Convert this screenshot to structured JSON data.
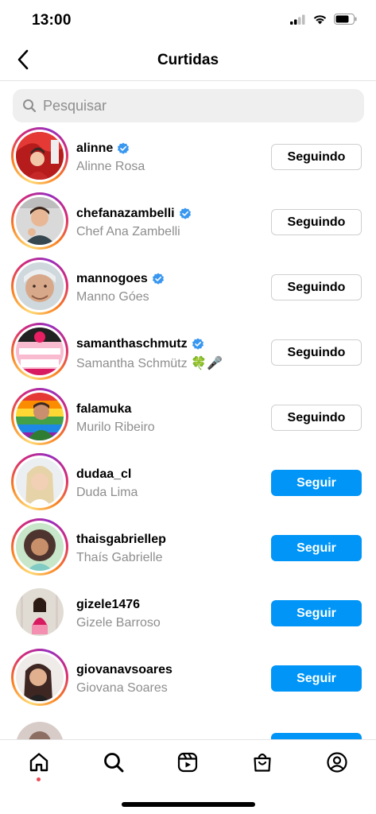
{
  "status_bar": {
    "time": "13:00",
    "icons": [
      "signal-icon",
      "wifi-icon",
      "battery-icon"
    ]
  },
  "header": {
    "title": "Curtidas",
    "back_icon": "chevron-left-icon"
  },
  "search": {
    "placeholder": "Pesquisar",
    "value": ""
  },
  "colors": {
    "accent": "#0095f6",
    "secondary_text": "#8e8e8e",
    "verified": "#3897f0",
    "notification_dot": "#ed4956"
  },
  "users": [
    {
      "username": "alinne",
      "full_name": "Alinne Rosa",
      "verified": true,
      "button": "Seguindo",
      "has_story": true
    },
    {
      "username": "chefanazambelli",
      "full_name": "Chef Ana Zambelli",
      "verified": true,
      "button": "Seguindo",
      "has_story": true
    },
    {
      "username": "mannogoes",
      "full_name": "Manno Góes",
      "verified": true,
      "button": "Seguindo",
      "has_story": true
    },
    {
      "username": "samanthaschmutz",
      "full_name": "Samantha Schmütz 🍀🎤",
      "verified": true,
      "button": "Seguindo",
      "has_story": true
    },
    {
      "username": "falamuka",
      "full_name": "Murilo Ribeiro",
      "verified": false,
      "button": "Seguindo",
      "has_story": true
    },
    {
      "username": "dudaa_cl",
      "full_name": "Duda Lima",
      "verified": false,
      "button": "Seguir",
      "has_story": true
    },
    {
      "username": "thaisgabriellep",
      "full_name": "Thaís Gabrielle",
      "verified": false,
      "button": "Seguir",
      "has_story": true
    },
    {
      "username": "gizele1476",
      "full_name": "Gizele Barroso",
      "verified": false,
      "button": "Seguir",
      "has_story": false
    },
    {
      "username": "giovanavsoares",
      "full_name": "Giovana Soares",
      "verified": false,
      "button": "Seguir",
      "has_story": true
    },
    {
      "username": "",
      "full_name": "",
      "verified": false,
      "button": "",
      "has_story": false
    }
  ],
  "tab_bar": {
    "items": [
      "home-icon",
      "search-icon",
      "reels-icon",
      "shop-icon",
      "profile-icon"
    ],
    "active": "home"
  }
}
